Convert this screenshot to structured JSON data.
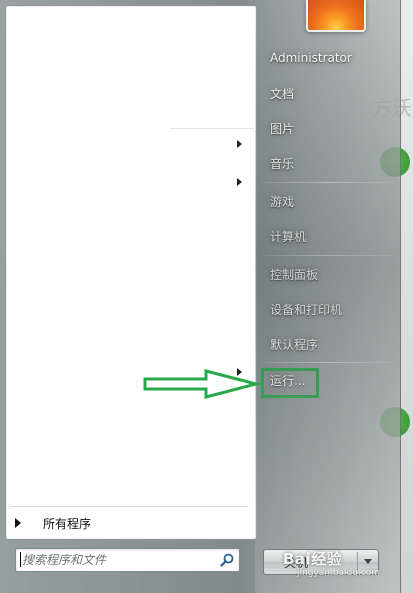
{
  "user": {
    "name": "Administrator"
  },
  "right_links": [
    {
      "label": "文档"
    },
    {
      "label": "图片"
    },
    {
      "label": "音乐"
    },
    {
      "label": "游戏"
    },
    {
      "label": "计算机"
    },
    {
      "label": "控制面板"
    },
    {
      "label": "设备和打印机"
    },
    {
      "label": "默认程序"
    },
    {
      "label": "运行..."
    }
  ],
  "left_pane": {
    "all_programs_label": "所有程序"
  },
  "search": {
    "placeholder": "搜索程序和文件"
  },
  "shutdown": {
    "label": "关机"
  },
  "desktop": {
    "background_glyph": "方沃"
  },
  "watermark": {
    "brand": "Bai经验",
    "url": "jingyan.baidu.com"
  },
  "colors": {
    "highlight_box": "#27a84a",
    "annotation_arrow": "#27a84a",
    "green_dot": "#3f9e3b"
  },
  "icons": {
    "search": "search-icon",
    "submenu": "chevron-right-icon",
    "shutdown_options": "chevron-down-icon",
    "all_programs": "triangle-right-icon"
  }
}
